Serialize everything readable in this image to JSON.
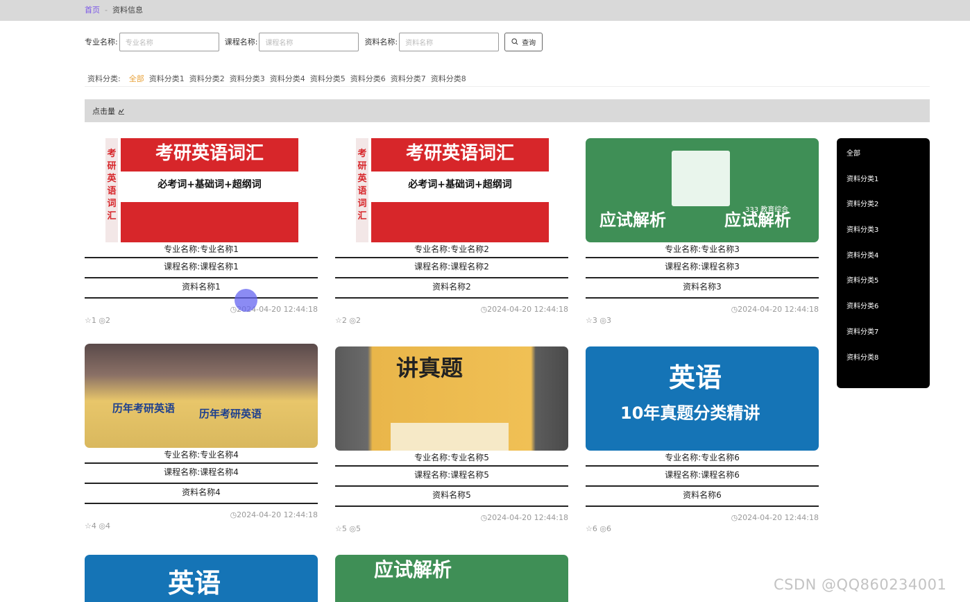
{
  "breadcrumb": {
    "home": "首页",
    "sep": "-",
    "current": "资料信息"
  },
  "search": {
    "major_label": "专业名称:",
    "major_placeholder": "专业名称",
    "course_label": "课程名称:",
    "course_placeholder": "课程名称",
    "material_label": "资料名称:",
    "material_placeholder": "资料名称",
    "query_label": "查询"
  },
  "categories": {
    "title": "资料分类:",
    "items": [
      "全部",
      "资料分类1",
      "资料分类2",
      "资料分类3",
      "资料分类4",
      "资料分类5",
      "资料分类6",
      "资料分类7",
      "资料分类8"
    ],
    "active": "全部"
  },
  "sort": {
    "label": "点击量"
  },
  "cards": [
    {
      "major": "专业名称:专业名称1",
      "course": "课程名称:课程名称1",
      "name": "资料名称1",
      "date": "2024-04-20 12:44:18",
      "stars": "1",
      "views": "2"
    },
    {
      "major": "专业名称:专业名称2",
      "course": "课程名称:课程名称2",
      "name": "资料名称2",
      "date": "2024-04-20 12:44:18",
      "stars": "2",
      "views": "2"
    },
    {
      "major": "专业名称:专业名称3",
      "course": "课程名称:课程名称3",
      "name": "资料名称3",
      "date": "2024-04-20 12:44:18",
      "stars": "3",
      "views": "3"
    },
    {
      "major": "专业名称:专业名称4",
      "course": "课程名称:课程名称4",
      "name": "资料名称4",
      "date": "2024-04-20 12:44:18",
      "stars": "4",
      "views": "4"
    },
    {
      "major": "专业名称:专业名称5",
      "course": "课程名称:课程名称5",
      "name": "资料名称5",
      "date": "2024-04-20 12:44:18",
      "stars": "5",
      "views": "5"
    },
    {
      "major": "专业名称:专业名称6",
      "course": "课程名称:课程名称6",
      "name": "资料名称6",
      "date": "2024-04-20 12:44:18",
      "stars": "6",
      "views": "6"
    }
  ],
  "book_texts": {
    "red_title": "考研英语词汇",
    "red_sub": "必考词+基础词+超纲词",
    "red_spine": "考研英语词汇",
    "green_title": "应试解析",
    "green_num": "333 教育综合",
    "blue_title": "英语",
    "blue_sub": "10年真题分类精讲",
    "photo5_title": "讲真题",
    "photo4_title": "历年考研英语"
  },
  "sidebar": {
    "items": [
      "全部",
      "资料分类1",
      "资料分类2",
      "资料分类3",
      "资料分类4",
      "资料分类5",
      "资料分类6",
      "资料分类7",
      "资料分类8"
    ]
  },
  "watermark": "CSDN @QQ860234001",
  "colors": {
    "accent": "#e8a23a",
    "breadcrumb_home": "#7b57e8",
    "sidebar_bg": "#000000",
    "bar_bg": "#d9d9d9"
  }
}
